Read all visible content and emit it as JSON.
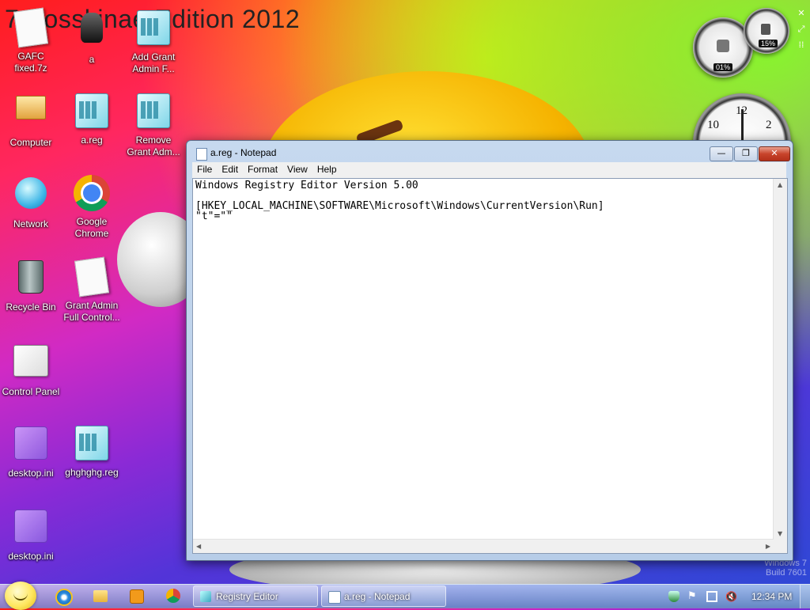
{
  "wallpaper_text": "7 Bosskinae Edition 2012",
  "desktop_icons": [
    {
      "label": "GAFC fixed.7z"
    },
    {
      "label": "a"
    },
    {
      "label": "Add Grant Admin F..."
    },
    {
      "label": "Computer"
    },
    {
      "label": "a.reg"
    },
    {
      "label": "Remove Grant Adm..."
    },
    {
      "label": "Network"
    },
    {
      "label": "Google Chrome"
    },
    {
      "label": "Recycle Bin"
    },
    {
      "label": "Grant Admin Full Control..."
    },
    {
      "label": "Control Panel"
    },
    {
      "label": "desktop.ini"
    },
    {
      "label": "ghghghg.reg"
    },
    {
      "label": "desktop.ini"
    }
  ],
  "gadgets": {
    "cpu_percent": "01%",
    "memory_percent": "15%",
    "clock_numbers": [
      "10",
      "12",
      "2"
    ]
  },
  "notepad": {
    "title": "a.reg - Notepad",
    "menu": [
      "File",
      "Edit",
      "Format",
      "View",
      "Help"
    ],
    "content": "Windows Registry Editor Version 5.00\n\n[HKEY_LOCAL_MACHINE\\SOFTWARE\\Microsoft\\Windows\\CurrentVersion\\Run]\n\"t\"=\"\"",
    "min_glyph": "—",
    "max_glyph": "❐",
    "close_glyph": "✕"
  },
  "taskbar": {
    "buttons": [
      {
        "label": "Registry Editor"
      },
      {
        "label": "a.reg - Notepad"
      }
    ],
    "time": "12:34 PM"
  },
  "watermark": {
    "line1": "Windows 7",
    "line2": "Build 7601"
  },
  "colors": {
    "accent": "#3d6fb5",
    "close_red": "#c8442b"
  }
}
